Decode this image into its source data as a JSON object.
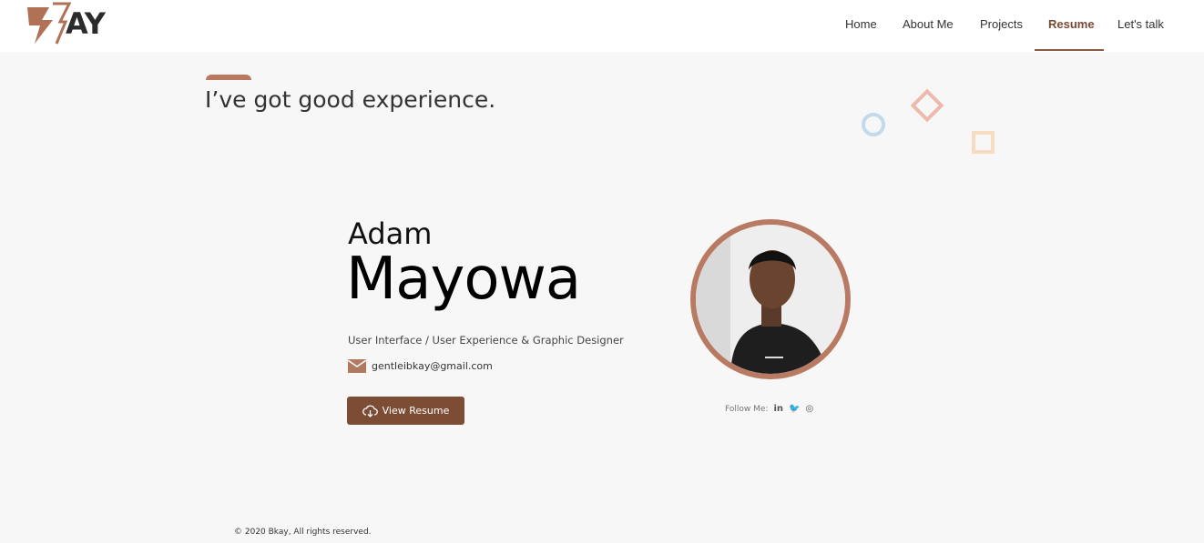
{
  "brand": {
    "logo_text": "AY",
    "logo_mark_color": "#b07155"
  },
  "nav": {
    "items": [
      {
        "label": "Home"
      },
      {
        "label": "About Me"
      },
      {
        "label": "Projects"
      },
      {
        "label": "Resume",
        "active": true
      },
      {
        "label": "Let's talk"
      }
    ]
  },
  "hero": {
    "headline": "I’ve got good experience."
  },
  "profile": {
    "first_name": "Adam",
    "last_name": "Mayowa",
    "role": "User Interface / User Experience & Graphic Designer",
    "email": "gentleibkay@gmail.com",
    "button_label": "View Resume",
    "follow_label": "Follow Me:",
    "social": [
      "in",
      "🐦",
      "◎"
    ]
  },
  "footer": {
    "copyright": "© 2020 Bkay, All rights reserved."
  },
  "colors": {
    "accent": "#7d4c35",
    "accent_light": "#b87a62",
    "background": "#f7f7f7"
  }
}
